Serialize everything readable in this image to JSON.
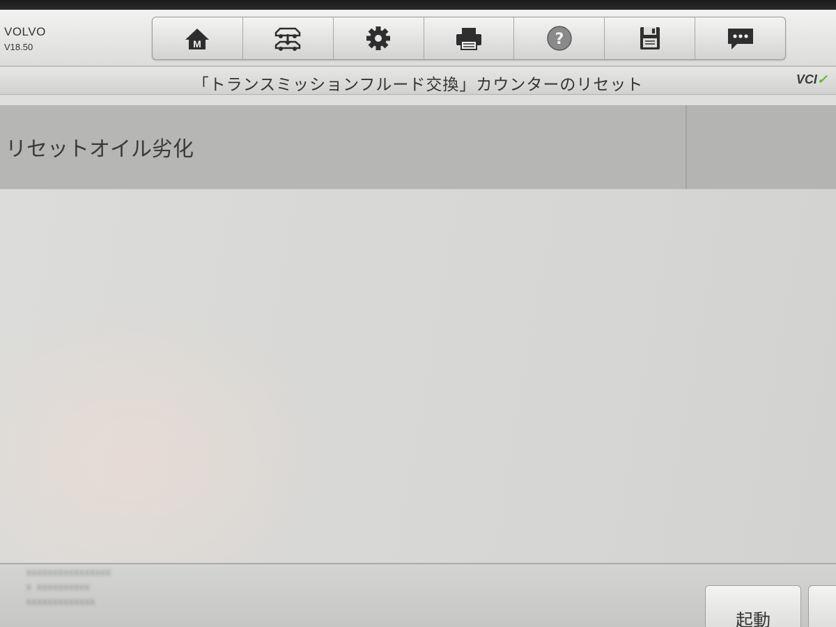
{
  "header": {
    "make": "VOLVO",
    "version": "V18.50",
    "buttons": [
      {
        "name": "home-button",
        "icon": "home-m-icon"
      },
      {
        "name": "vehicle-swap-button",
        "icon": "vehicle-swap-icon"
      },
      {
        "name": "settings-button",
        "icon": "gear-icon"
      },
      {
        "name": "print-button",
        "icon": "printer-icon"
      },
      {
        "name": "help-button",
        "icon": "help-icon"
      },
      {
        "name": "save-button",
        "icon": "floppy-disk-icon"
      },
      {
        "name": "message-button",
        "icon": "chat-bubble-icon"
      }
    ]
  },
  "titlebar": {
    "title": "「トランスミッションフルード交換」カウンターのリセット",
    "vci_label": "VCI",
    "vci_status_color": "#5cb82e"
  },
  "function_row": {
    "label": "リセットオイル劣化",
    "value": ""
  },
  "footer": {
    "info_lines": [
      "XXXXXXXXXXXXXXXX",
      "X XXXXXXXXXX",
      "XXXXXXXXXXXXX"
    ],
    "start_label": "起動"
  }
}
